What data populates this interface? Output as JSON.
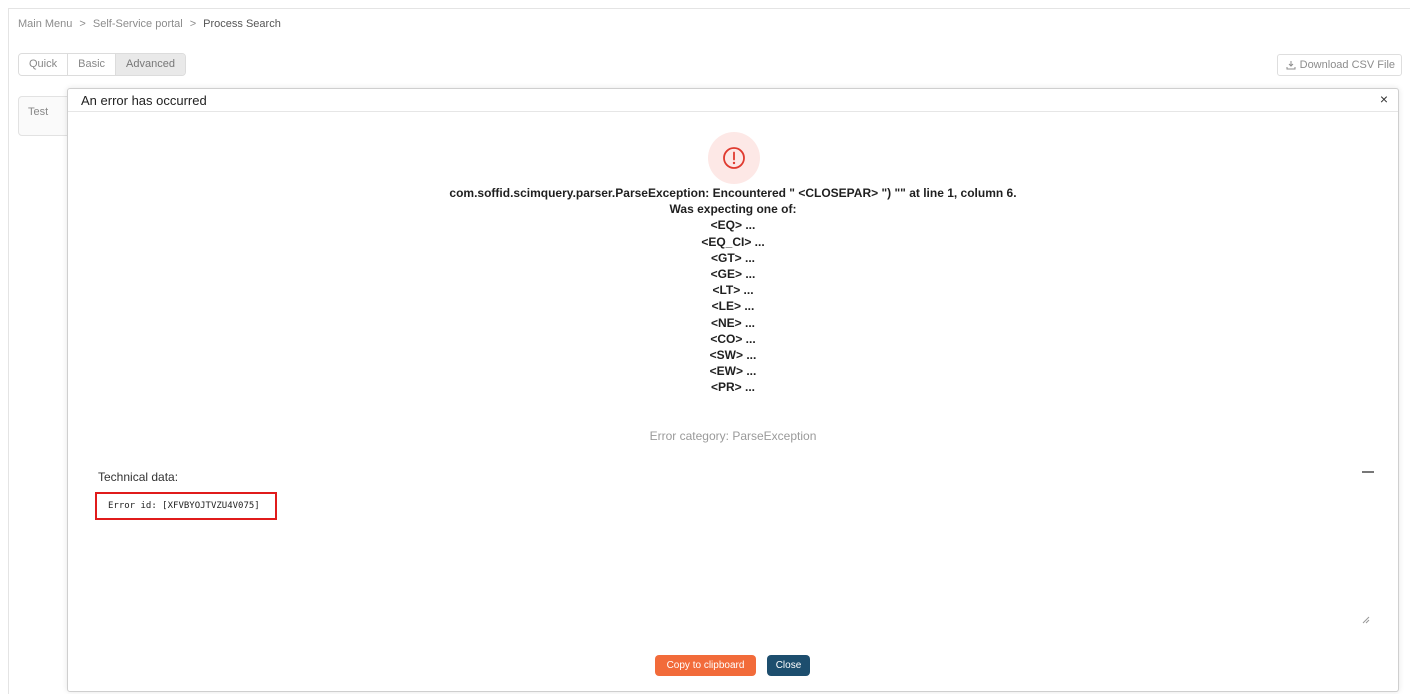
{
  "breadcrumb": {
    "items": [
      "Main Menu",
      "Self-Service portal",
      "Process Search"
    ],
    "separator": ">"
  },
  "tabs": [
    {
      "label": "Quick"
    },
    {
      "label": "Basic"
    },
    {
      "label": "Advanced"
    }
  ],
  "active_tab": "Advanced",
  "download_label": "Download CSV File",
  "background_panel_label": "Test",
  "dialog": {
    "title": "An error has occurred",
    "close_glyph": "×",
    "message_lines": [
      "com.soffid.scimquery.parser.ParseException: Encountered \" <CLOSEPAR> \") \"\" at line 1, column 6.",
      "Was expecting one of:",
      "<EQ> ...",
      "<EQ_CI> ...",
      "<GT> ...",
      "<GE> ...",
      "<LT> ...",
      "<LE> ...",
      "<NE> ...",
      "<CO> ...",
      "<SW> ...",
      "<EW> ...",
      "<PR> ..."
    ],
    "error_category": "Error category: ParseException",
    "technical_data_label": "Technical data:",
    "technical_data_value": "Error id: [XFVBYOJTVZU4V075]",
    "copy_button": "Copy to clipboard",
    "close_button": "Close"
  },
  "colors": {
    "accent_orange": "#f26b3a",
    "accent_navy": "#1d4e6e",
    "error_red": "#e03a2f",
    "highlight_red": "#e01b1b"
  }
}
